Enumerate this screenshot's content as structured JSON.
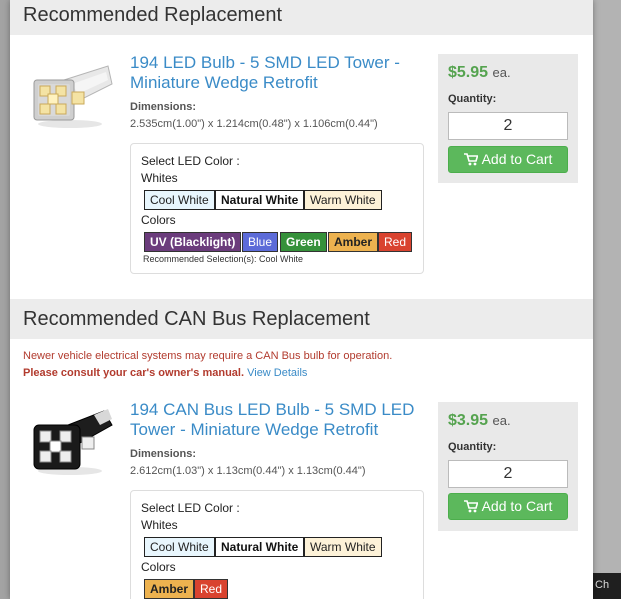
{
  "sections": {
    "replacement_title": "Recommended Replacement",
    "canbus_title": "Recommended CAN Bus Replacement"
  },
  "canbus_notice": {
    "line1": "Newer vehicle electrical systems may require a CAN Bus bulb for operation.",
    "line2_bold": "Please consult your car's owner's manual.",
    "link": "View Details"
  },
  "products": [
    {
      "title_line1": "194 LED Bulb - 5 SMD LED Tower -",
      "title_line2": "Miniature Wedge Retrofit",
      "dimensions_label": "Dimensions:",
      "dimensions": "2.535cm(1.00\") x 1.214cm(0.48\") x 1.106cm(0.44\")",
      "select_label": "Select LED Color :",
      "whites_label": "Whites",
      "whites": [
        "Cool White",
        "Natural White",
        "Warm White"
      ],
      "colors_label": "Colors",
      "colors": [
        "UV (Blacklight)",
        "Blue",
        "Green",
        "Amber",
        "Red"
      ],
      "recommended": "Recommended Selection(s): Cool White",
      "price": "$5.95",
      "price_unit": "ea.",
      "quantity_label": "Quantity:",
      "quantity": "2",
      "add_to_cart": "Add to Cart"
    },
    {
      "title_line1": "194 CAN Bus LED Bulb - 5 SMD LED",
      "title_line2": "Tower - Miniature Wedge Retrofit",
      "dimensions_label": "Dimensions:",
      "dimensions": "2.612cm(1.03\") x 1.13cm(0.44\") x 1.13cm(0.44\")",
      "select_label": "Select LED Color :",
      "whites_label": "Whites",
      "whites": [
        "Cool White",
        "Natural White",
        "Warm White"
      ],
      "colors_label": "Colors",
      "colors": [
        "Amber",
        "Red"
      ],
      "price": "$3.95",
      "price_unit": "ea.",
      "quantity_label": "Quantity:",
      "quantity": "2",
      "add_to_cart": "Add to Cart"
    }
  ],
  "chat_tab": "Ch",
  "colors": {
    "link_blue": "#3a8bc7",
    "price_green": "#55a34f",
    "cart_button": "#5cb85c",
    "notice_red": "#b23b2e",
    "section_header_bg": "#ececec"
  }
}
